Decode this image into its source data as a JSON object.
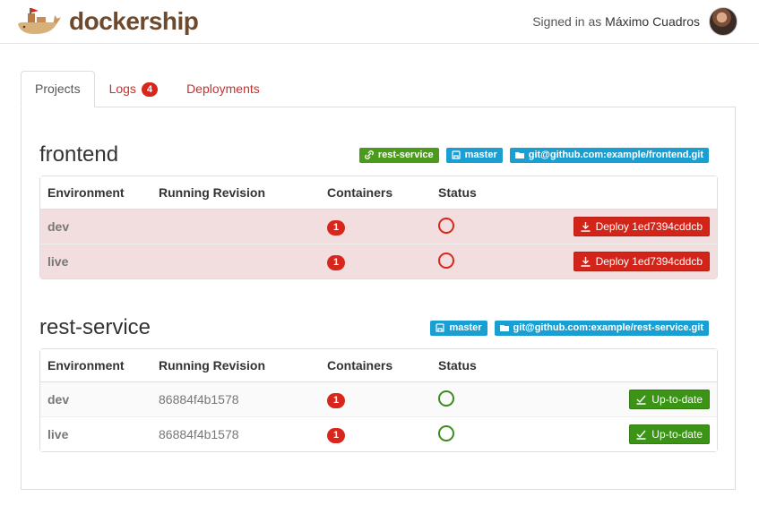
{
  "brand": {
    "name": "dockership"
  },
  "user": {
    "prefix": "Signed in as",
    "name": "Máximo Cuadros"
  },
  "tabs": [
    {
      "label": "Projects"
    },
    {
      "label": "Logs",
      "count": "4"
    },
    {
      "label": "Deployments"
    }
  ],
  "table_headers": {
    "environment": "Environment",
    "revision": "Running Revision",
    "containers": "Containers",
    "status": "Status"
  },
  "projects": [
    {
      "name": "frontend",
      "labels": [
        {
          "text": "rest-service",
          "icon": "link-icon",
          "color": "#4a9a1c"
        },
        {
          "text": "master",
          "icon": "branch-icon",
          "color": "#1a9fd3"
        },
        {
          "text": "git@github.com:example/frontend.git",
          "icon": "folder-icon",
          "color": "#1a9fd3"
        }
      ],
      "rows": [
        {
          "env": "dev",
          "revision": "",
          "containers": "1",
          "status": "error",
          "action": "Deploy 1ed7394cddcb"
        },
        {
          "env": "live",
          "revision": "",
          "containers": "1",
          "status": "error",
          "action": "Deploy 1ed7394cddcb"
        }
      ]
    },
    {
      "name": "rest-service",
      "labels": [
        {
          "text": "master",
          "icon": "branch-icon",
          "color": "#1a9fd3"
        },
        {
          "text": "git@github.com:example/rest-service.git",
          "icon": "folder-icon",
          "color": "#1a9fd3"
        }
      ],
      "rows": [
        {
          "env": "dev",
          "revision": "86884f4b1578",
          "containers": "1",
          "status": "ok",
          "action": "Up-to-date"
        },
        {
          "env": "live",
          "revision": "86884f4b1578",
          "containers": "1",
          "status": "ok",
          "action": "Up-to-date"
        }
      ]
    }
  ],
  "colors": {
    "danger": "#d9261c",
    "success": "#3b9416",
    "info": "#1a9fd3",
    "brand": "#6d4a2d"
  }
}
